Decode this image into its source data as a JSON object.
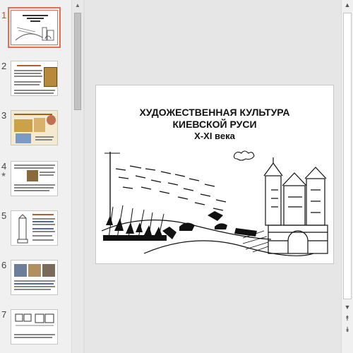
{
  "thumbnails": [
    {
      "number": "1",
      "active": true,
      "has_animation": false
    },
    {
      "number": "2",
      "active": false,
      "has_animation": false
    },
    {
      "number": "3",
      "active": false,
      "has_animation": false
    },
    {
      "number": "4",
      "active": false,
      "has_animation": true
    },
    {
      "number": "5",
      "active": false,
      "has_animation": false
    },
    {
      "number": "6",
      "active": false,
      "has_animation": false
    },
    {
      "number": "7",
      "active": false,
      "has_animation": false
    }
  ],
  "animation_marker": "★",
  "slide": {
    "title_line1": "ХУДОЖЕСТВЕННАЯ КУЛЬТУРА",
    "title_line2": "КИЕВСКОЙ РУСИ",
    "title_line3": "X-XI века"
  },
  "icons": {
    "scroll_up": "▲",
    "scroll_down": "▼",
    "prev_slide": "⯭",
    "next_slide": "⯯"
  },
  "colors": {
    "active_accent": "#d24726",
    "selection_border": "#e07050"
  }
}
